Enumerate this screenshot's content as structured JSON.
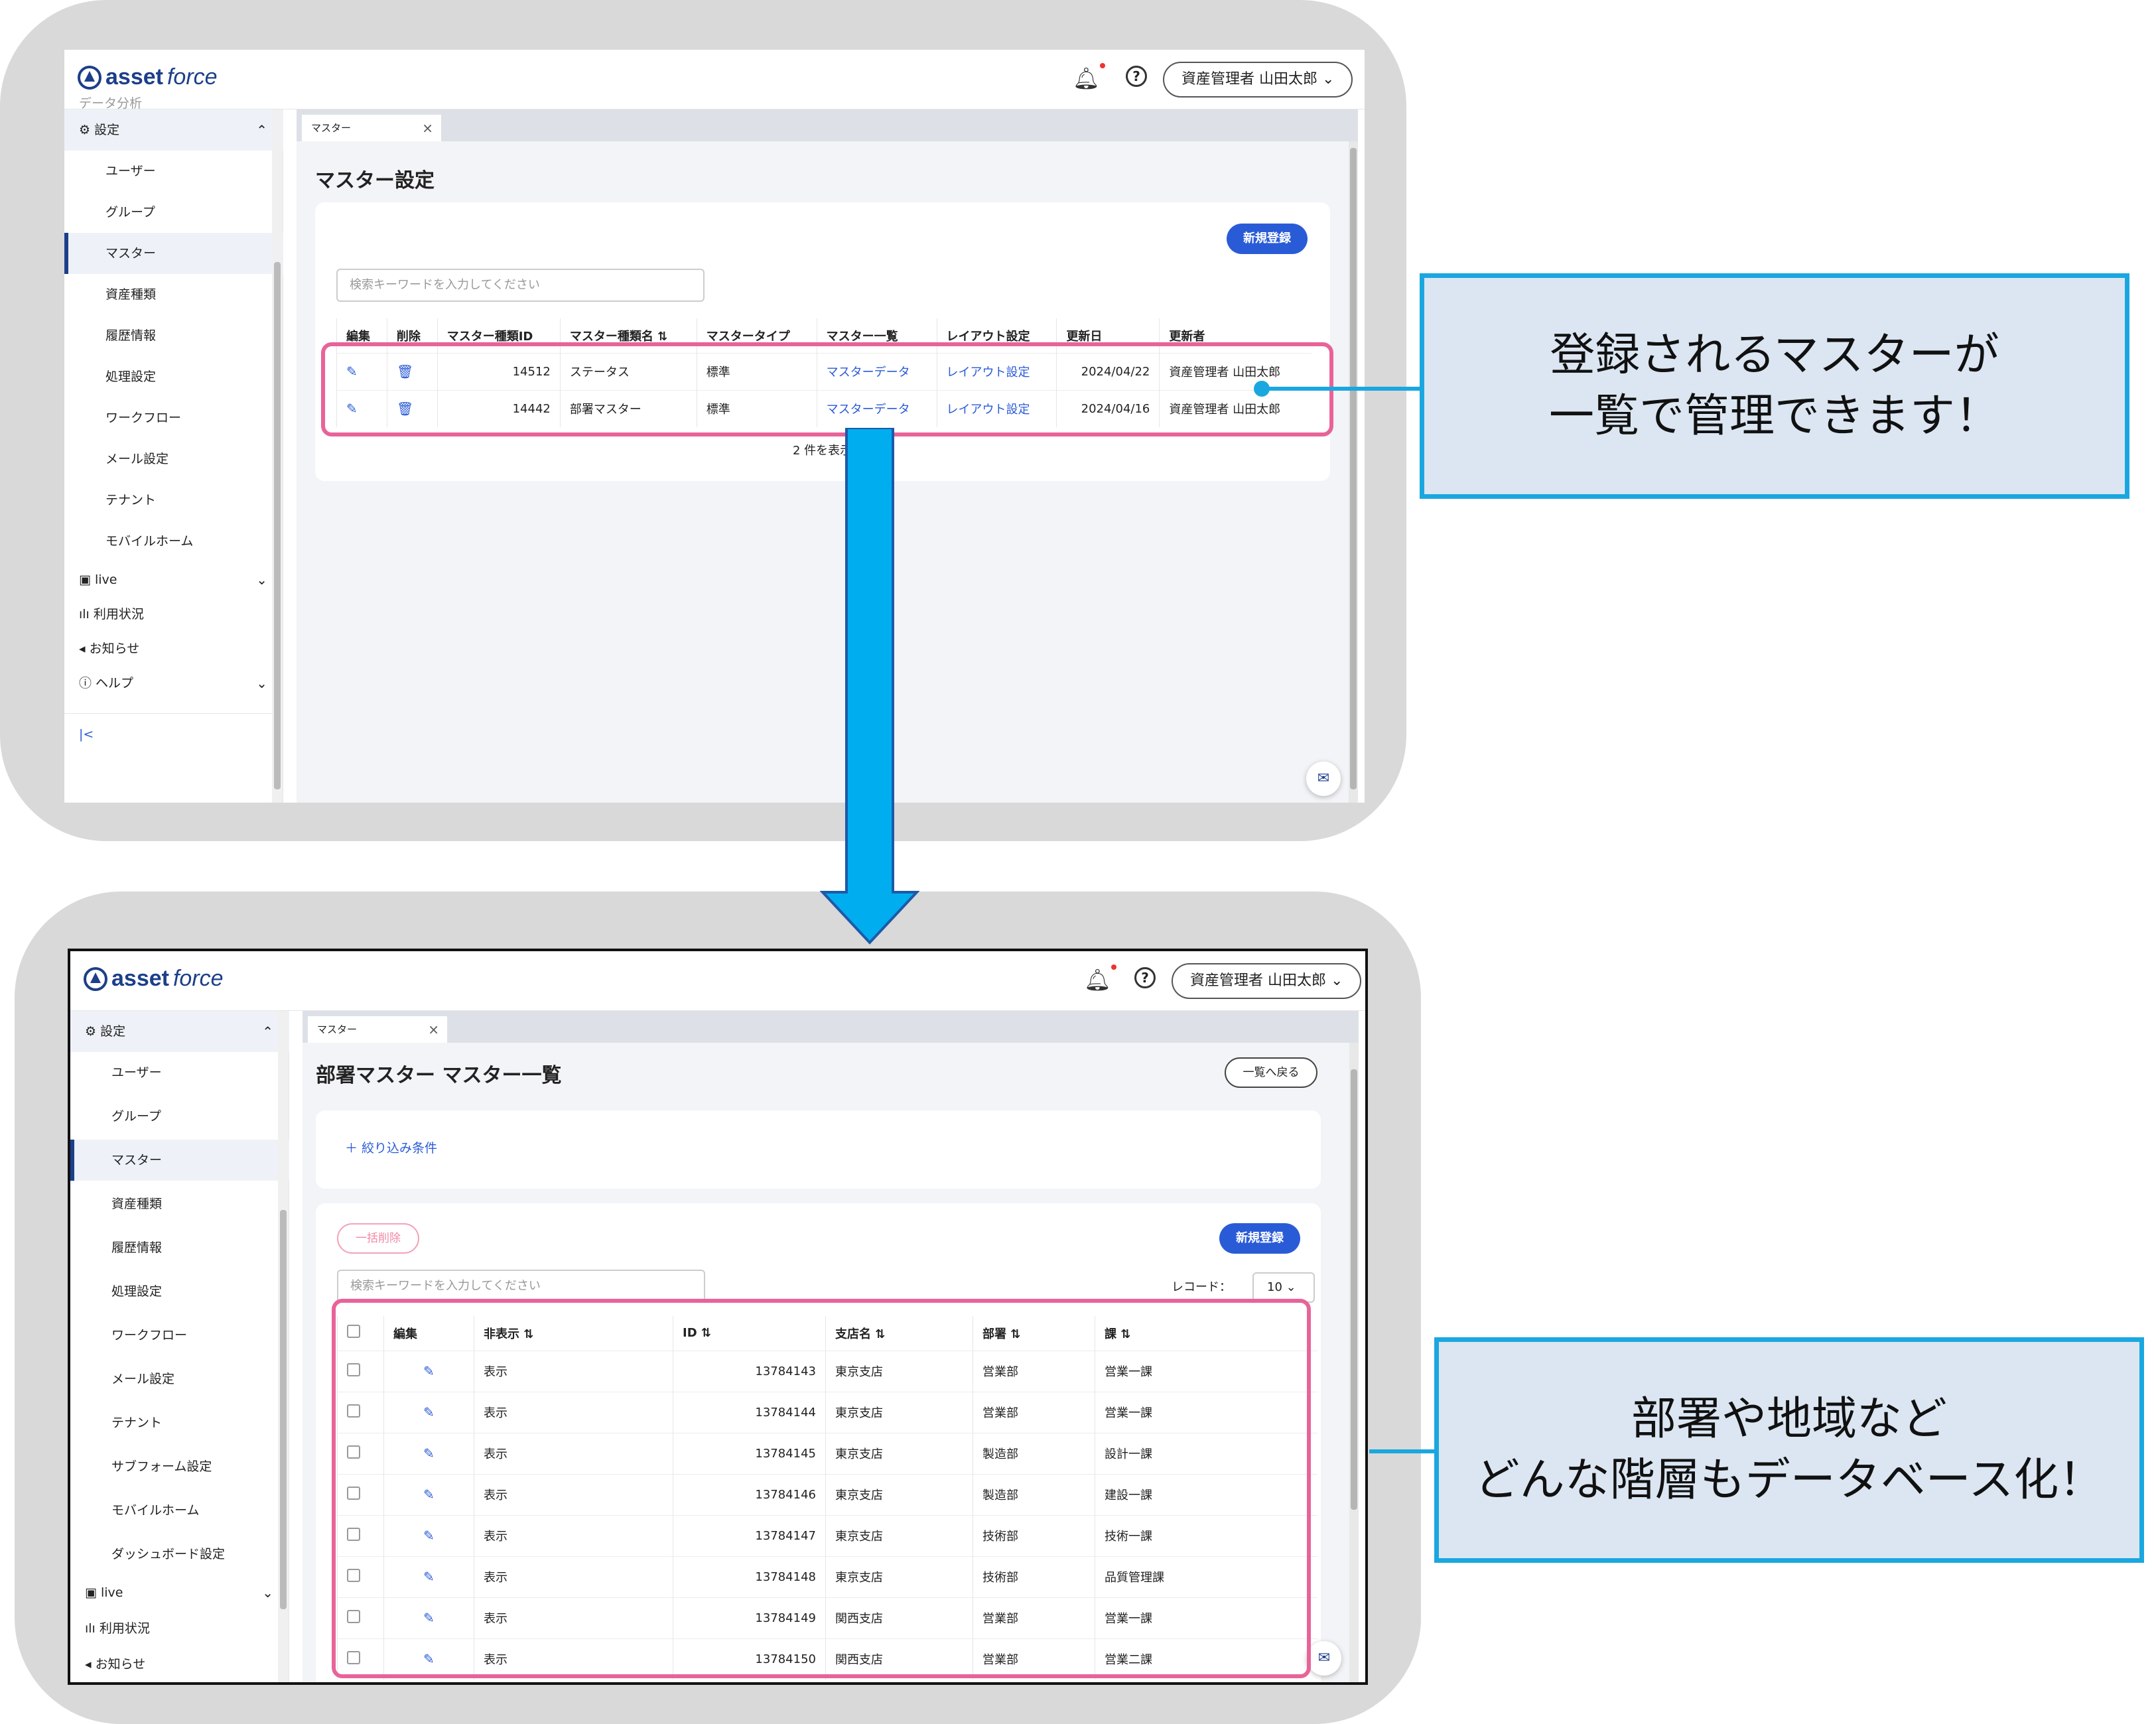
{
  "app": {
    "logo_bold": "asset",
    "logo_italic": "force",
    "user": "資産管理者 山田太郎"
  },
  "sidebar": {
    "partial_top": "データ分析",
    "group": "設定",
    "items1": [
      "ユーザー",
      "グループ",
      "マスター",
      "資産種類",
      "履歴情報",
      "処理設定",
      "ワークフロー",
      "メール設定",
      "テナント",
      "モバイルホーム"
    ],
    "items2": [
      "ユーザー",
      "グループ",
      "マスター",
      "資産種類",
      "履歴情報",
      "処理設定",
      "ワークフロー",
      "メール設定",
      "テナント",
      "サブフォーム設定",
      "モバイルホーム",
      "ダッシュボード設定"
    ],
    "live": "live",
    "usage": "利用状況",
    "notice": "お知らせ",
    "help": "ヘルプ",
    "collapse": "|<"
  },
  "tab": {
    "label": "マスター"
  },
  "screen1": {
    "title": "マスター設定",
    "new_button": "新規登録",
    "search_placeholder": "検索キーワードを入力してください",
    "headers": [
      "編集",
      "削除",
      "マスター種類ID",
      "マスター種類名 ⇅",
      "マスタータイプ",
      "マスター一覧",
      "レイアウト設定",
      "更新日",
      "更新者"
    ],
    "rows": [
      {
        "id": "14512",
        "name": "ステータス",
        "type": "標準",
        "list": "マスターデータ",
        "layout": "レイアウト設定",
        "date": "2024/04/22",
        "user": "資産管理者 山田太郎"
      },
      {
        "id": "14442",
        "name": "部署マスター",
        "type": "標準",
        "list": "マスターデータ",
        "layout": "レイアウト設定",
        "date": "2024/04/16",
        "user": "資産管理者 山田太郎"
      }
    ],
    "count": "2 件を表示"
  },
  "screen2": {
    "title": "部署マスター マスター一覧",
    "back_button": "一覧へ戻る",
    "filter": "＋ 絞り込み条件",
    "bulk_delete": "一括削除",
    "new_button": "新規登録",
    "search_placeholder": "検索キーワードを入力してください",
    "record_label": "レコード：",
    "record_value": "10",
    "headers": [
      "",
      "編集",
      "非表示 ⇅",
      "ID ⇅",
      "支店名 ⇅",
      "部署 ⇅",
      "課 ⇅"
    ],
    "rows": [
      {
        "vis": "表示",
        "id": "13784143",
        "branch": "東京支店",
        "dept": "営業部",
        "sec": "営業一課"
      },
      {
        "vis": "表示",
        "id": "13784144",
        "branch": "東京支店",
        "dept": "営業部",
        "sec": "営業一課"
      },
      {
        "vis": "表示",
        "id": "13784145",
        "branch": "東京支店",
        "dept": "製造部",
        "sec": "設計一課"
      },
      {
        "vis": "表示",
        "id": "13784146",
        "branch": "東京支店",
        "dept": "製造部",
        "sec": "建設一課"
      },
      {
        "vis": "表示",
        "id": "13784147",
        "branch": "東京支店",
        "dept": "技術部",
        "sec": "技術一課"
      },
      {
        "vis": "表示",
        "id": "13784148",
        "branch": "東京支店",
        "dept": "技術部",
        "sec": "品質管理課"
      },
      {
        "vis": "表示",
        "id": "13784149",
        "branch": "関西支店",
        "dept": "営業部",
        "sec": "営業一課"
      },
      {
        "vis": "表示",
        "id": "13784150",
        "branch": "関西支店",
        "dept": "営業部",
        "sec": "営業二課"
      }
    ]
  },
  "callouts": {
    "c1_line1": "登録されるマスターが",
    "c1_line2": "一覧で管理できます！",
    "c2_line1": "部署や地域など",
    "c2_line2": "どんな階層もデータベース化！"
  },
  "colors": {
    "accent": "#2a5bd7",
    "brand": "#1d3f8a",
    "highlight": "#e8639a",
    "callout_border": "#1aa7e0",
    "callout_bg": "#dbe6f2"
  }
}
